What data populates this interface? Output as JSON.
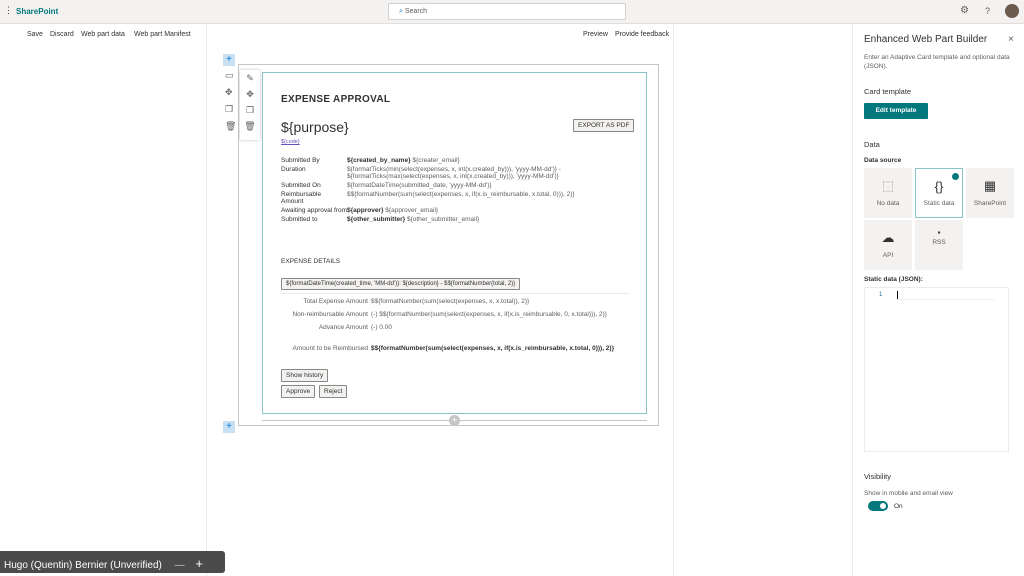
{
  "topbar": {
    "brand": "SharePoint",
    "search_placeholder": "Search"
  },
  "commands": {
    "save": "Save",
    "discard": "Discard",
    "web_part_data": "Web part data",
    "web_part_manifest": "Web part Manifest",
    "preview": "Preview",
    "feedback": "Provide feedback"
  },
  "card": {
    "title": "EXPENSE APPROVAL",
    "purpose": "${purpose}",
    "code": "${code}",
    "export": "EXPORT AS PDF",
    "facts": [
      {
        "label": "Submitted By",
        "bold": "${created_by_name}",
        "value": " ${creater_email}"
      },
      {
        "label": "Duration",
        "bold": "",
        "value": "${formatTicks(min(select(expenses, x, int(x.created_by))), 'yyyy-MM-dd')} - ${formatTicks(max(select(expenses, x, int(x.created_by))), 'yyyy-MM-dd')}"
      },
      {
        "label": "Submitted On",
        "bold": "",
        "value": "${formatDateTime(submitted_date, 'yyyy-MM-dd')}"
      },
      {
        "label": "Reimbursable Amount",
        "bold": "",
        "value": "$${formatNumber(sum(select(expenses, x, if(x.is_reimbursable, x.total, 0))), 2)}"
      },
      {
        "label": "Awaiting approval from",
        "bold": "${approver}",
        "value": " ${approver_email}"
      },
      {
        "label": "Submitted to",
        "bold": "${other_submitter}",
        "value": " ${other_submitter_email}"
      }
    ],
    "details_heading": "EXPENSE DETAILS",
    "expense_item": "${formatDateTime(created_time, 'MM-dd')}: ${description} - $${formatNumber(total, 2)}",
    "totals": [
      {
        "label": "Total Expense Amount",
        "value": "$${formatNumber(sum(select(expenses, x, x.total)), 2)}"
      },
      {
        "label": "Non-reimbursable Amount",
        "value": "(-) $${formatNumber(sum(select(expenses, x, if(x.is_reimbursable, 0, x.total))), 2)}"
      },
      {
        "label": "Advance Amount",
        "value": "(-) 0.00"
      }
    ],
    "reimburse_label": "Amount to be Reimbursed",
    "reimburse_value": "$${formatNumber(sum(select(expenses, x, if(x.is_reimbursable, x.total, 0))), 2)}",
    "show_history": "Show history",
    "approve": "Approve",
    "reject": "Reject"
  },
  "panel": {
    "title": "Enhanced Web Part Builder",
    "desc": "Enter an Adaptive Card template and optional data (JSON).",
    "card_template": "Card template",
    "edit_template": "Edit template",
    "data": "Data",
    "data_source": "Data source",
    "sources": [
      "No data",
      "Static data",
      "SharePoint",
      "API",
      "RSS"
    ],
    "static_label": "Static data (JSON):",
    "line_no": "1",
    "visibility": "Visibility",
    "show_mobile": "Show in mobile and email view",
    "toggle": "On"
  },
  "presenter": "Hugo (Quentin) Bernier (Unverified)",
  "colors": {
    "accent": "#03787c"
  }
}
